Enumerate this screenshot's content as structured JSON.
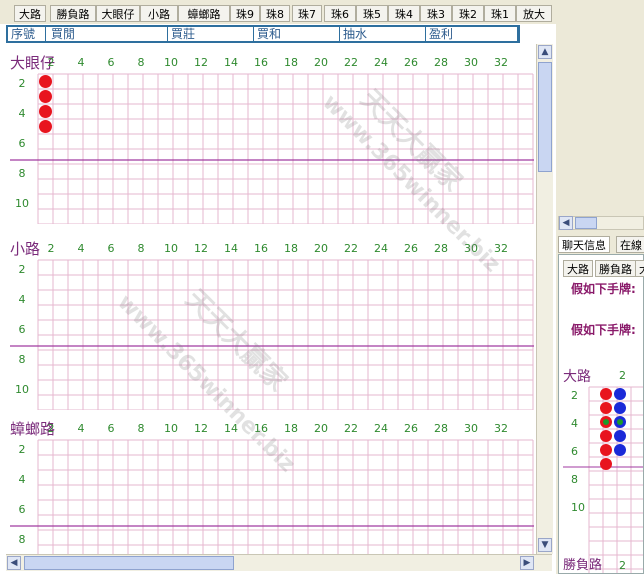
{
  "road_tabs": [
    "大路",
    "勝負路",
    "大眼仔",
    "小路",
    "蟑螂路",
    "珠9",
    "珠8",
    "珠7",
    "珠6",
    "珠5",
    "珠4",
    "珠3",
    "珠2",
    "珠1",
    "放大"
  ],
  "columns": [
    "序號",
    "買閒",
    "買莊",
    "買和",
    "抽水",
    "盈利"
  ],
  "panels": [
    {
      "label": "大眼仔",
      "col_numbers": [
        "2",
        "4",
        "6",
        "8",
        "10",
        "12",
        "14",
        "16",
        "18",
        "20",
        "22",
        "24",
        "26",
        "28",
        "30",
        "32"
      ],
      "row_numbers": [
        "2",
        "4",
        "6",
        "8",
        "10"
      ],
      "dots": [
        {
          "col": 1,
          "row": 1,
          "color": "red"
        },
        {
          "col": 1,
          "row": 2,
          "color": "red"
        },
        {
          "col": 1,
          "row": 3,
          "color": "red"
        },
        {
          "col": 1,
          "row": 4,
          "color": "red"
        }
      ]
    },
    {
      "label": "小路",
      "col_numbers": [
        "2",
        "4",
        "6",
        "8",
        "10",
        "12",
        "14",
        "16",
        "18",
        "20",
        "22",
        "24",
        "26",
        "28",
        "30",
        "32"
      ],
      "row_numbers": [
        "2",
        "4",
        "6",
        "8",
        "10"
      ],
      "dots": []
    },
    {
      "label": "蟑螂路",
      "col_numbers": [
        "2",
        "4",
        "6",
        "8",
        "10",
        "12",
        "14",
        "16",
        "18",
        "20",
        "22",
        "24",
        "26",
        "28",
        "30",
        "32"
      ],
      "row_numbers": [
        "2",
        "4",
        "6",
        "8"
      ],
      "dots": []
    }
  ],
  "right": {
    "tabs_top": [
      "聊天信息",
      "在線"
    ],
    "tabs_second": [
      "大路",
      "勝負路",
      "大"
    ],
    "message_1": "假如下手牌:",
    "message_2": "假如下手牌:",
    "road_label": "大路",
    "road_col_number": "2",
    "road_row_numbers": [
      "2",
      "4",
      "6",
      "8",
      "10"
    ],
    "bottom_label": "勝負路",
    "bottom_number": "2",
    "dots": [
      {
        "col": 1,
        "row": 1,
        "color": "red"
      },
      {
        "col": 2,
        "row": 1,
        "color": "blue"
      },
      {
        "col": 1,
        "row": 2,
        "color": "red"
      },
      {
        "col": 2,
        "row": 2,
        "color": "blue"
      },
      {
        "col": 1,
        "row": 3,
        "color": "green-red"
      },
      {
        "col": 2,
        "row": 3,
        "color": "green-blue"
      },
      {
        "col": 1,
        "row": 4,
        "color": "red"
      },
      {
        "col": 2,
        "row": 4,
        "color": "blue"
      },
      {
        "col": 1,
        "row": 5,
        "color": "red"
      },
      {
        "col": 2,
        "row": 5,
        "color": "blue"
      },
      {
        "col": 1,
        "row": 6,
        "color": "red"
      }
    ]
  },
  "watermarks": [
    "天天大贏家",
    "www.365winner.biz"
  ],
  "colors": {
    "grid": "#e6b7cf",
    "midline": "#a03aa0",
    "label": "#7a2a7a",
    "numbers": "#2f8a2f",
    "red": "#e8141e",
    "blue": "#1a2ad8",
    "green": "#1a9a2a"
  }
}
